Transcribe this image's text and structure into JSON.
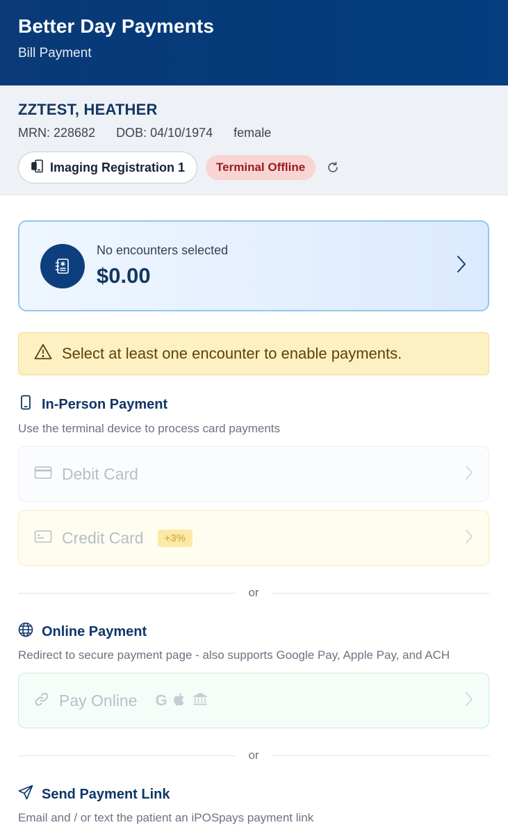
{
  "header": {
    "title": "Better Day Payments",
    "subtitle": "Bill Payment"
  },
  "patient": {
    "name": "ZZTEST, HEATHER",
    "mrn": "MRN: 228682",
    "dob": "DOB: 04/10/1974",
    "sex": "female",
    "location": "Imaging Registration 1",
    "terminal_status": "Terminal Offline",
    "status_color": "#f8d4d4"
  },
  "encounters": {
    "label": "No encounters selected",
    "amount": "$0.00"
  },
  "alert": {
    "text": "Select at least one encounter to enable payments."
  },
  "in_person": {
    "title": "In-Person Payment",
    "description": "Use the terminal device to process card payments",
    "options": [
      {
        "label": "Debit Card",
        "icon": "credit-card-icon"
      },
      {
        "label": "Credit Card",
        "icon": "card-outline-icon",
        "badge": "+3%"
      }
    ]
  },
  "divider_or": "or",
  "online": {
    "title": "Online Payment",
    "description": "Redirect to secure payment page - also supports Google Pay, Apple Pay, and ACH",
    "option": {
      "label": "Pay Online",
      "icon": "link-icon",
      "brands": [
        "google-icon",
        "apple-icon",
        "bank-icon"
      ]
    }
  },
  "send_link": {
    "title": "Send Payment Link",
    "description": "Email and / or text the patient an iPOSpays payment link"
  },
  "colors": {
    "brand": "#0a3a78",
    "accent": "#90c8ea",
    "alert_bg": "#fdf0c2"
  }
}
